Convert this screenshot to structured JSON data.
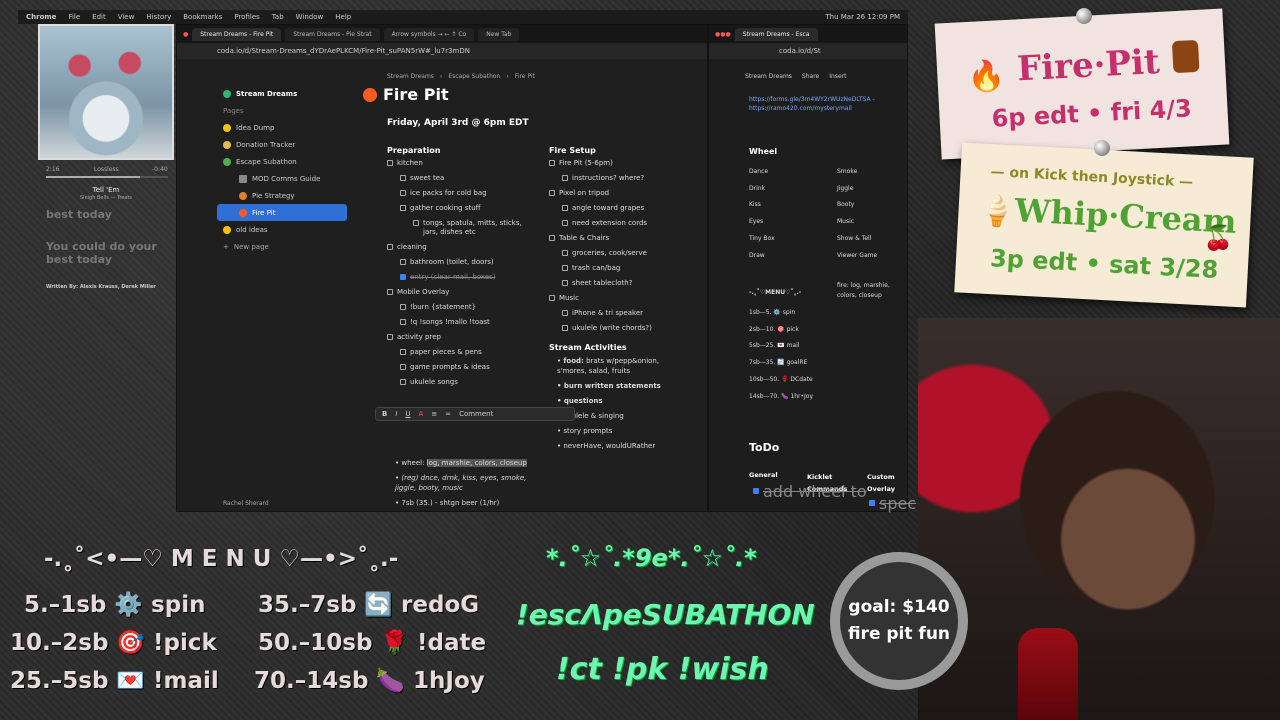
{
  "macbar": {
    "app": "Chrome",
    "menus": [
      "File",
      "Edit",
      "View",
      "History",
      "Bookmarks",
      "Profiles",
      "Tab",
      "Window",
      "Help"
    ],
    "clock": "Thu Mar 26 12:09 PM"
  },
  "player": {
    "time_elapsed": "2:16",
    "quality": "Lossless",
    "time_remaining": "-0:40",
    "track": "Tell 'Em",
    "artist": "Sleigh Bells — Treats",
    "lyric1": "best today",
    "lyric2": "You could do your best today",
    "credits": "Written By: Alexis Krauss, Derek Miller"
  },
  "win1": {
    "tabs": [
      "Stream Dreams - Fire Pit",
      "Stream Dreams - Pie Strat",
      "Arrow symbols → ← ↑ Co",
      "New Tab"
    ],
    "url": "coda.io/d/Stream-Dreams_dYDrAePLKCM/Fire-Pit_suPAN5rW#_lu7r3mDN",
    "breadcrumb": [
      "Stream Dreams",
      "Escape Subathon",
      "Fire Pit"
    ],
    "sidebar": {
      "workspace": "Stream Dreams",
      "pages_label": "Pages",
      "items": [
        "Idea Dump",
        "Donation Tracker",
        "Escape Subathon",
        "MOD Comms Guide",
        "Pie Strategy",
        "Fire Pit",
        "old ideas"
      ],
      "new_page": "New page",
      "user": "Rachel Sherard"
    },
    "doc": {
      "title": "Fire Pit",
      "date": "Friday, April 3rd @ 6pm EDT",
      "prep_title": "Preparation",
      "prep": [
        {
          "t": "kitchen",
          "lvl": 0
        },
        {
          "t": "sweet tea",
          "lvl": 1
        },
        {
          "t": "ice packs for cold bag",
          "lvl": 1
        },
        {
          "t": "gather cooking stuff",
          "lvl": 1
        },
        {
          "t": "tongs, spatula, mitts, sticks, jars, dishes etc",
          "lvl": 2
        },
        {
          "t": "cleaning",
          "lvl": 0
        },
        {
          "t": "bathroom (toilet, doors)",
          "lvl": 1
        },
        {
          "t": "entry (clear mail, boxes)",
          "lvl": 1,
          "done": true
        },
        {
          "t": "Mobile Overlay",
          "lvl": 0
        },
        {
          "t": "!burn {statement}",
          "lvl": 1
        },
        {
          "t": "!q !songs !mallo !toast",
          "lvl": 1
        },
        {
          "t": "activity prep",
          "lvl": 0
        },
        {
          "t": "paper pieces & pens",
          "lvl": 1
        },
        {
          "t": "game prompts & ideas",
          "lvl": 1
        },
        {
          "t": "ukulele songs",
          "lvl": 1
        }
      ],
      "bullets": [
        {
          "pre": "wheel: ",
          "hl": "log, marshie, colors, closeup"
        },
        {
          "pre": "(reg) dnce, drnk, kiss, eyes, smoke, jiggle, booty, music",
          "hl": ""
        },
        {
          "pre": "7sb (35.) - shtgn beer (1/hr)",
          "hl": ""
        }
      ],
      "setup_title": "Fire Setup",
      "setup": [
        {
          "t": "Fire Pit (5-6pm)",
          "lvl": 0
        },
        {
          "t": "instructions? where?",
          "lvl": 1
        },
        {
          "t": "Pixel on tripod",
          "lvl": 0
        },
        {
          "t": "angle toward grapes",
          "lvl": 1
        },
        {
          "t": "need extension cords",
          "lvl": 1
        },
        {
          "t": "Table & Chairs",
          "lvl": 0
        },
        {
          "t": "groceries, cook/serve",
          "lvl": 1
        },
        {
          "t": "trash can/bag",
          "lvl": 1
        },
        {
          "t": "sheet tablecloth?",
          "lvl": 1
        },
        {
          "t": "Music",
          "lvl": 0
        },
        {
          "t": "iPhone & tri speaker",
          "lvl": 1
        },
        {
          "t": "ukulele (write chords?)",
          "lvl": 1
        }
      ],
      "act_title": "Stream Activities",
      "acts": [
        "food: brats w/pepp&onion, s'mores, salad, fruits",
        "burn written statements",
        "questions",
        "ukulele & singing",
        "story prompts",
        "neverHave, wouldURather"
      ],
      "comment": "Comment"
    }
  },
  "win2": {
    "tab": "Stream Dreams - Esca",
    "url": "coda.io/d/St",
    "breadcrumb": "Stream Dreams",
    "share": "Share",
    "insert": "Insert",
    "links": [
      "https://forms.gle/3m4WY2rWUzNeDLTSA -",
      "https://ramo420.com/mysterymail"
    ],
    "wheel_title": "Wheel",
    "wheel_col1": [
      "Dance",
      "Drink",
      "Kiss",
      "Eyes",
      "Tiny Box",
      "Draw"
    ],
    "wheel_col2": [
      "Smoke",
      "Jiggle",
      "Booty",
      "Music",
      "Show & Tell",
      "Viewer Game"
    ],
    "menu_title": "-.˳˚♡MENU♡˚˳.-",
    "menu": [
      "1sb—5. ⚙️ spin",
      "2sb—10. 🎯 pick",
      "5sb—25. 💌 mail",
      "7sb—35. 🔄 goalRE",
      "10sb—50. 🌹 DCdate",
      "14sb—70. 🍆 1hr•Joy"
    ],
    "fire_note": "fire: log, marshie, colors, closeup",
    "todo_title": "ToDo",
    "todo_cols": [
      "General",
      "Kicklet Commands",
      "Custom Overlay"
    ],
    "todo_items": [
      "add wheel to",
      "spec"
    ]
  },
  "notes": {
    "fire_title": "Fire·Pit",
    "fire_time": "6p edt • fri 4/3",
    "kick_line": "— on Kick then Joystick —",
    "whip_title": "Whip·Cream",
    "whip_time": "3p edt • sat 3/28"
  },
  "overlay": {
    "menu_head": "-.˳˚<•—♡ M E N U ♡—•>˚˳.-",
    "menu_left": [
      "5.–1sb ⚙️ spin",
      "10.–2sb 🎯 !pick",
      "25.–5sb 💌 !mail"
    ],
    "menu_right": [
      "35.–7sb 🔄 redoG",
      "50.–10sb 🌹 !date",
      "70.–14sb 🍆 1hJoy"
    ],
    "green_top": "*.˚☆˚.*9e*.˚☆˚.*",
    "green_mid": "!escΛpeSUBATHON",
    "green_bot": "!ct !pk !wish",
    "goal_line1": "goal: $140",
    "goal_line2": "fire pit fun"
  }
}
